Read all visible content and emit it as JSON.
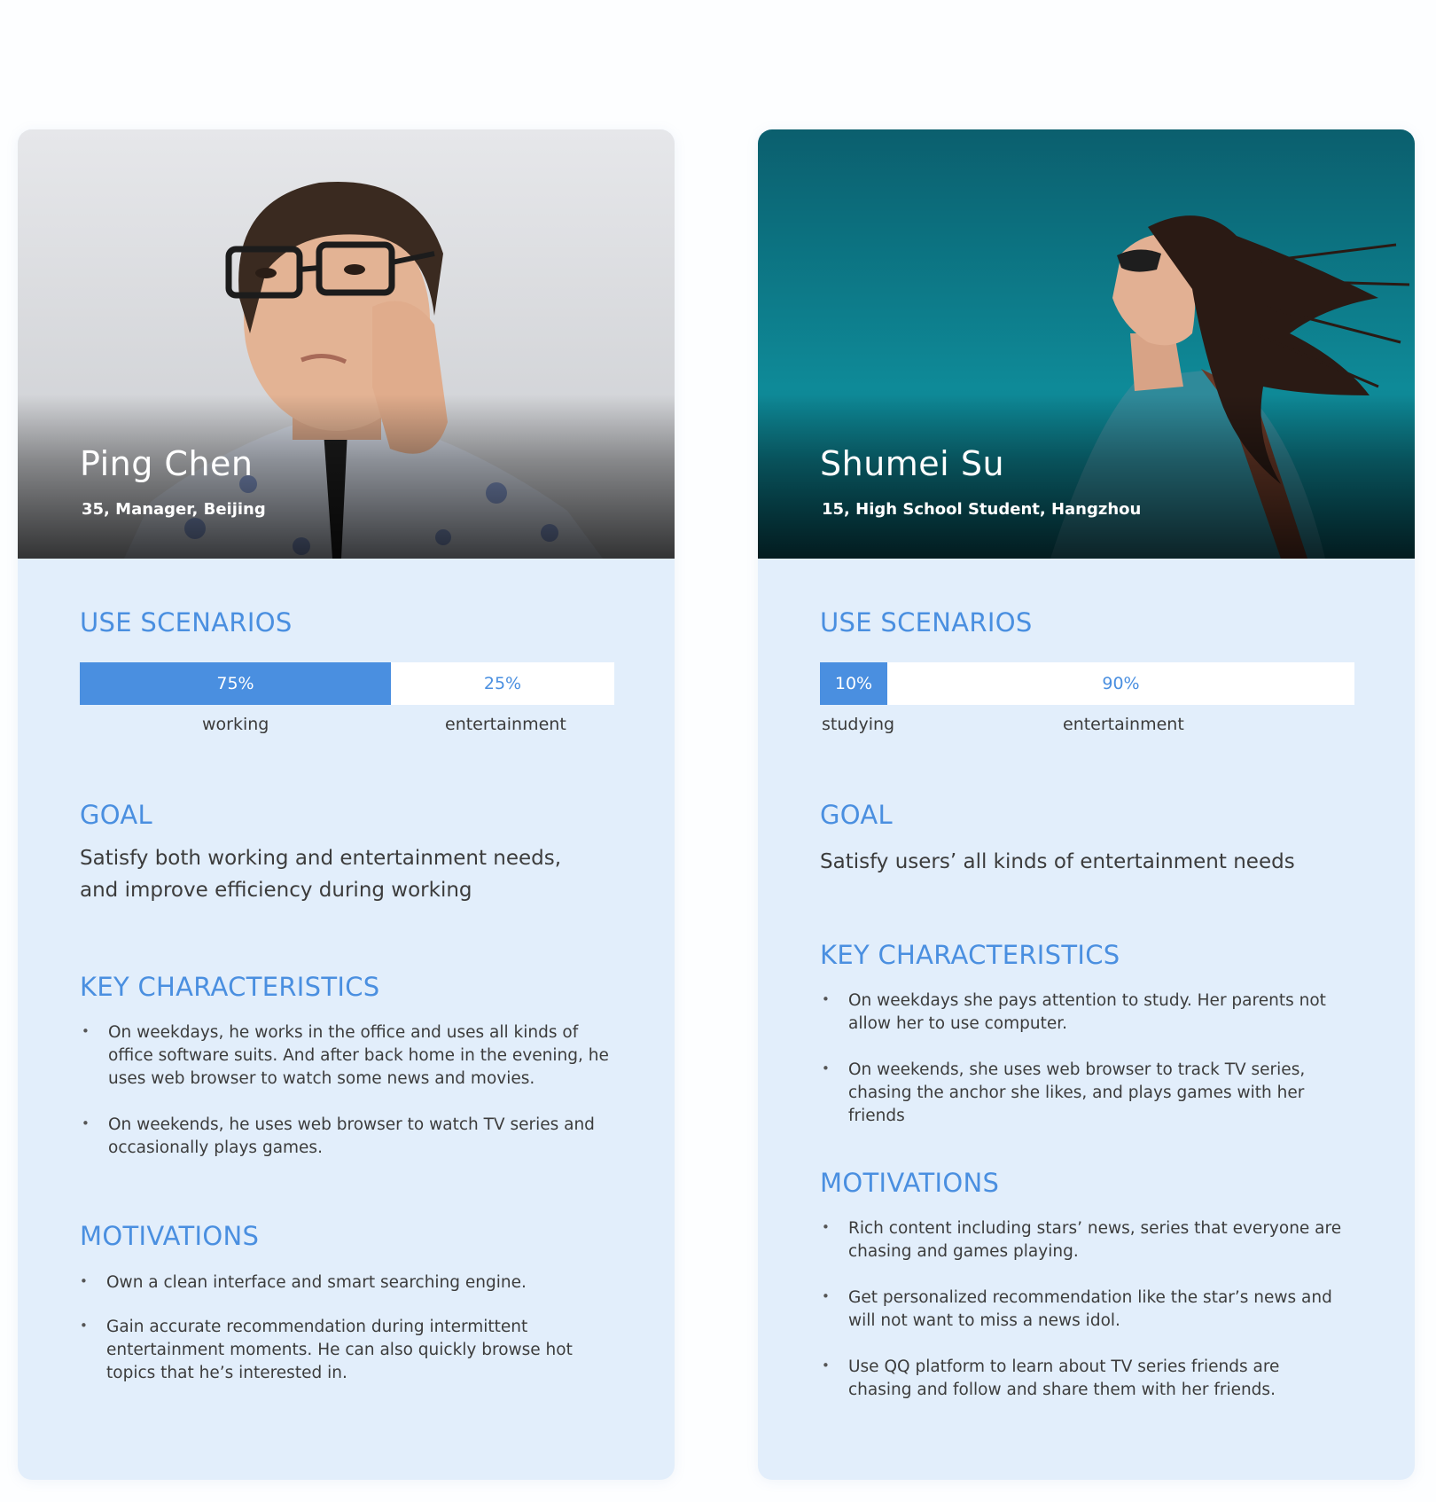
{
  "colors": {
    "accent": "#4a8fe0",
    "card_background": "#e2eefb",
    "text": "#3c3c3c"
  },
  "personas": [
    {
      "name": "Ping Chen",
      "meta": "35, Manager, Beijing",
      "photo_icon": "portrait-photo",
      "use_scenarios_title": "USE SCENARIOS",
      "scenario_bar": [
        {
          "label": "working",
          "percent_text": "75%",
          "fraction": 0.75
        },
        {
          "label": "entertainment",
          "percent_text": "25%",
          "fraction": 0.25
        }
      ],
      "goal_title": "GOAL",
      "goal_text": "Satisfy both working and entertainment needs, and improve efficiency during working",
      "characteristics_title": "KEY CHARACTERISTICS",
      "characteristics": [
        "On weekdays, he works in the office and uses all kinds of office software suits. And after back home in the evening, he uses web browser to watch some news and movies.",
        "On weekends, he uses web browser to watch TV series and occasionally plays games."
      ],
      "motivations_title": "MOTIVATIONS",
      "motivations": [
        "Own a clean interface and smart searching engine.",
        "Gain accurate recommendation during intermittent entertainment moments. He can also quickly browse hot topics that he’s interested in."
      ]
    },
    {
      "name": "Shumei Su",
      "meta": "15, High School Student, Hangzhou",
      "photo_icon": "portrait-photo",
      "use_scenarios_title": "USE SCENARIOS",
      "scenario_bar": [
        {
          "label": "studying",
          "percent_text": "10%",
          "fraction": 0.1
        },
        {
          "label": "entertainment",
          "percent_text": "90%",
          "fraction": 0.9
        }
      ],
      "goal_title": "GOAL",
      "goal_text": "Satisfy users’ all kinds of entertainment needs",
      "characteristics_title": "KEY CHARACTERISTICS",
      "characteristics": [
        "On weekdays she pays attention to study. Her parents not allow her to use computer.",
        "On weekends, she uses web browser to track TV series, chasing the anchor she likes, and plays games with her friends"
      ],
      "motivations_title": "MOTIVATIONS",
      "motivations": [
        "Rich content including stars’ news, series that everyone are chasing and games playing.",
        "Get personalized recommendation like the star’s news and will not want to miss a news idol.",
        "Use QQ platform to learn about TV series friends are chasing and follow and share them with her friends."
      ]
    }
  ]
}
